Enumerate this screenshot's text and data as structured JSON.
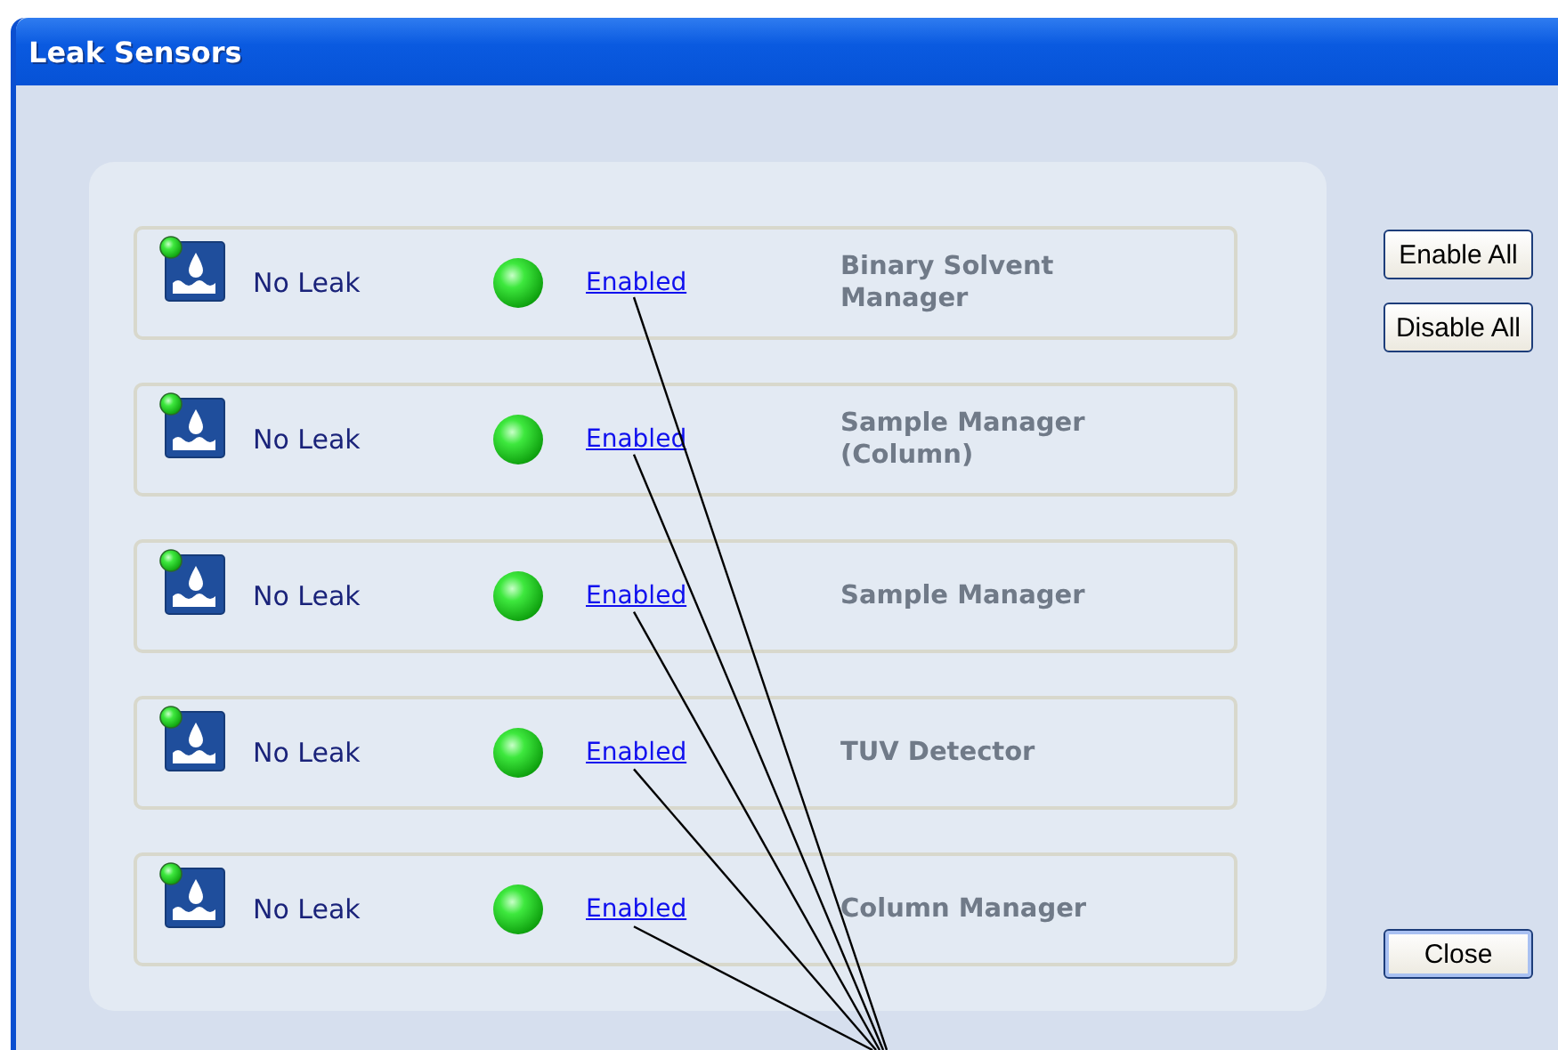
{
  "window": {
    "title": "Leak Sensors"
  },
  "sensors": [
    {
      "status": "No Leak",
      "led_on": true,
      "link": "Enabled",
      "name": "Binary Solvent Manager"
    },
    {
      "status": "No Leak",
      "led_on": true,
      "link": "Enabled",
      "name": "Sample Manager (Column)"
    },
    {
      "status": "No Leak",
      "led_on": true,
      "link": "Enabled",
      "name": "Sample Manager"
    },
    {
      "status": "No Leak",
      "led_on": true,
      "link": "Enabled",
      "name": "TUV Detector"
    },
    {
      "status": "No Leak",
      "led_on": true,
      "link": "Enabled",
      "name": "Column Manager"
    }
  ],
  "buttons": {
    "enable_all": "Enable All",
    "disable_all": "Disable All",
    "close": "Close"
  }
}
